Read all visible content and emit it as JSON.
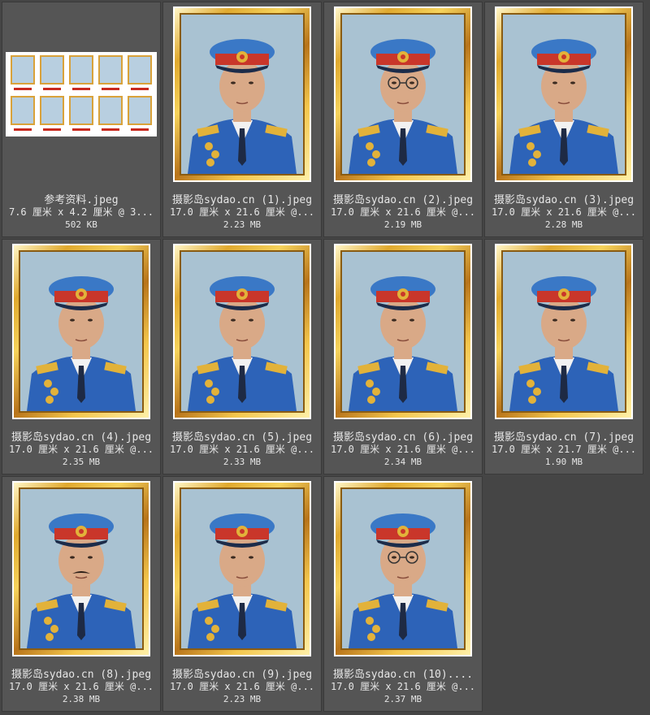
{
  "files": [
    {
      "name": "参考资料.jpeg",
      "dims": "7.6 厘米 x 4.2 厘米 @ 3...",
      "size": "502 KB",
      "kind": "reference"
    },
    {
      "name": "摄影岛sydao.cn (1).jpeg",
      "dims": "17.0 厘米 x 21.6 厘米 @...",
      "size": "2.23 MB",
      "kind": "portrait",
      "glasses": false,
      "mustache": false
    },
    {
      "name": "摄影岛sydao.cn (2).jpeg",
      "dims": "17.0 厘米 x 21.6 厘米 @...",
      "size": "2.19 MB",
      "kind": "portrait",
      "glasses": true,
      "mustache": false
    },
    {
      "name": "摄影岛sydao.cn (3).jpeg",
      "dims": "17.0 厘米 x 21.6 厘米 @...",
      "size": "2.28 MB",
      "kind": "portrait",
      "glasses": false,
      "mustache": false
    },
    {
      "name": "摄影岛sydao.cn (4).jpeg",
      "dims": "17.0 厘米 x 21.6 厘米 @...",
      "size": "2.35 MB",
      "kind": "portrait",
      "glasses": false,
      "mustache": false
    },
    {
      "name": "摄影岛sydao.cn (5).jpeg",
      "dims": "17.0 厘米 x 21.6 厘米 @...",
      "size": "2.33 MB",
      "kind": "portrait",
      "glasses": false,
      "mustache": false
    },
    {
      "name": "摄影岛sydao.cn (6).jpeg",
      "dims": "17.0 厘米 x 21.6 厘米 @...",
      "size": "2.34 MB",
      "kind": "portrait",
      "glasses": false,
      "mustache": false
    },
    {
      "name": "摄影岛sydao.cn (7).jpeg",
      "dims": "17.0 厘米 x 21.7 厘米 @...",
      "size": "1.90 MB",
      "kind": "portrait",
      "glasses": false,
      "mustache": false
    },
    {
      "name": "摄影岛sydao.cn (8).jpeg",
      "dims": "17.0 厘米 x 21.6 厘米 @...",
      "size": "2.38 MB",
      "kind": "portrait",
      "glasses": false,
      "mustache": true
    },
    {
      "name": "摄影岛sydao.cn (9).jpeg",
      "dims": "17.0 厘米 x 21.6 厘米 @...",
      "size": "2.23 MB",
      "kind": "portrait",
      "glasses": false,
      "mustache": false
    },
    {
      "name": "摄影岛sydao.cn (10)....",
      "dims": "17.0 厘米 x 21.6 厘米 @...",
      "size": "2.37 MB",
      "kind": "portrait",
      "glasses": true,
      "mustache": false
    }
  ],
  "colors": {
    "background": "#454545",
    "cell": "#555555",
    "text": "#e6e6e6",
    "portrait_bg": "#a9c2d2",
    "uniform": "#2d63b8",
    "cap": "#3a78c6",
    "cap_band": "#c9362a",
    "gold": "#e2b23a",
    "skin": "#d9a987"
  },
  "icons": {
    "thumbnail": "portrait-thumbnail-icon",
    "reference": "reference-sheet-icon"
  }
}
